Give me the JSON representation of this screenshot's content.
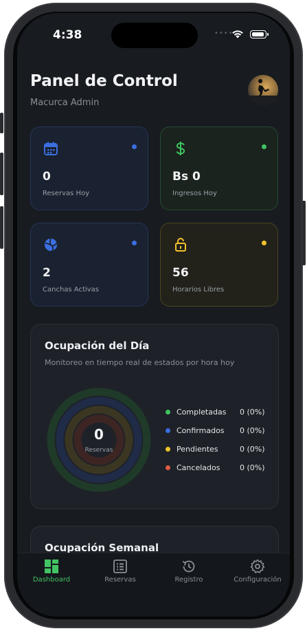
{
  "status": {
    "time": "4:38"
  },
  "header": {
    "title": "Panel de Control",
    "subtitle": "Macurca Admin"
  },
  "stats": [
    {
      "value": "0",
      "label": "Reservas Hoy",
      "icon": "calendar-icon",
      "color": "#3b6fe0"
    },
    {
      "value": "Bs 0",
      "label": "Ingresos Hoy",
      "icon": "dollar-icon",
      "color": "#3fc45f"
    },
    {
      "value": "2",
      "label": "Canchas Activas",
      "icon": "volleyball-icon",
      "color": "#3b6fe0"
    },
    {
      "value": "56",
      "label": "Horarios Libres",
      "icon": "unlock-icon",
      "color": "#f2c42b"
    }
  ],
  "occupancy": {
    "title": "Ocupación del Día",
    "subtitle": "Monitoreo en tiempo real de estados por hora hoy",
    "center_value": "0",
    "center_label": "Reservas",
    "legend": [
      {
        "name": "Completadas",
        "value": "0 (0%)",
        "color": "#3fc45f"
      },
      {
        "name": "Confirmados",
        "value": "0 (0%)",
        "color": "#3b6fe0"
      },
      {
        "name": "Pendientes",
        "value": "0 (0%)",
        "color": "#f2c42b"
      },
      {
        "name": "Cancelados",
        "value": "0 (0%)",
        "color": "#e05a43"
      }
    ]
  },
  "weekly": {
    "title": "Ocupación Semanal"
  },
  "tabs": [
    {
      "label": "Dashboard",
      "icon": "dashboard-icon",
      "active": true
    },
    {
      "label": "Reservas",
      "icon": "list-icon",
      "active": false
    },
    {
      "label": "Registro",
      "icon": "history-icon",
      "active": false
    },
    {
      "label": "Configuración",
      "icon": "gear-icon",
      "active": false
    }
  ]
}
